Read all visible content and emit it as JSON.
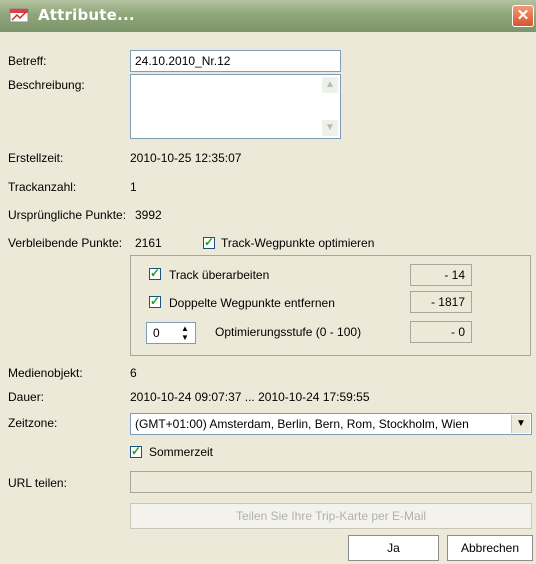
{
  "window": {
    "title": "Attribute...",
    "close_symbol": "✕"
  },
  "fields": {
    "betreff_label": "Betreff:",
    "betreff_value": "24.10.2010_Nr.12",
    "beschreibung_label": "Beschreibung:",
    "erstellzeit_label": "Erstellzeit:",
    "erstellzeit_value": "2010-10-25 12:35:07",
    "trackanzahl_label": "Trackanzahl:",
    "trackanzahl_value": "1",
    "urspruengliche_label": "Ursprüngliche Punkte:",
    "urspruengliche_value": "3992",
    "verbleibende_label": "Verbleibende Punkte:",
    "verbleibende_value": "2161",
    "optimize_label": "Track-Wegpunkte optimieren"
  },
  "optimization": {
    "track_label": "Track überarbeiten",
    "track_value": "- 14",
    "duplicates_label": "Doppelte Wegpunkte entfernen",
    "duplicates_value": "- 1817",
    "level_value": "0",
    "level_label": "Optimierungsstufe  (0 - 100)",
    "level_result": "- 0"
  },
  "media": {
    "medienobjekt_label": "Medienobjekt:",
    "medienobjekt_value": "6",
    "dauer_label": "Dauer:",
    "dauer_value": "2010-10-24 09:07:37 ... 2010-10-24 17:59:55",
    "zeitzone_label": "Zeitzone:",
    "zeitzone_value": "(GMT+01:00) Amsterdam, Berlin, Bern, Rom, Stockholm, Wien",
    "sommerzeit_label": "Sommerzeit",
    "url_label": "URL teilen:"
  },
  "buttons": {
    "share_label": "Teilen Sie Ihre Trip-Karte per E-Mail",
    "ok_label": "Ja",
    "cancel_label": "Abbrechen"
  }
}
